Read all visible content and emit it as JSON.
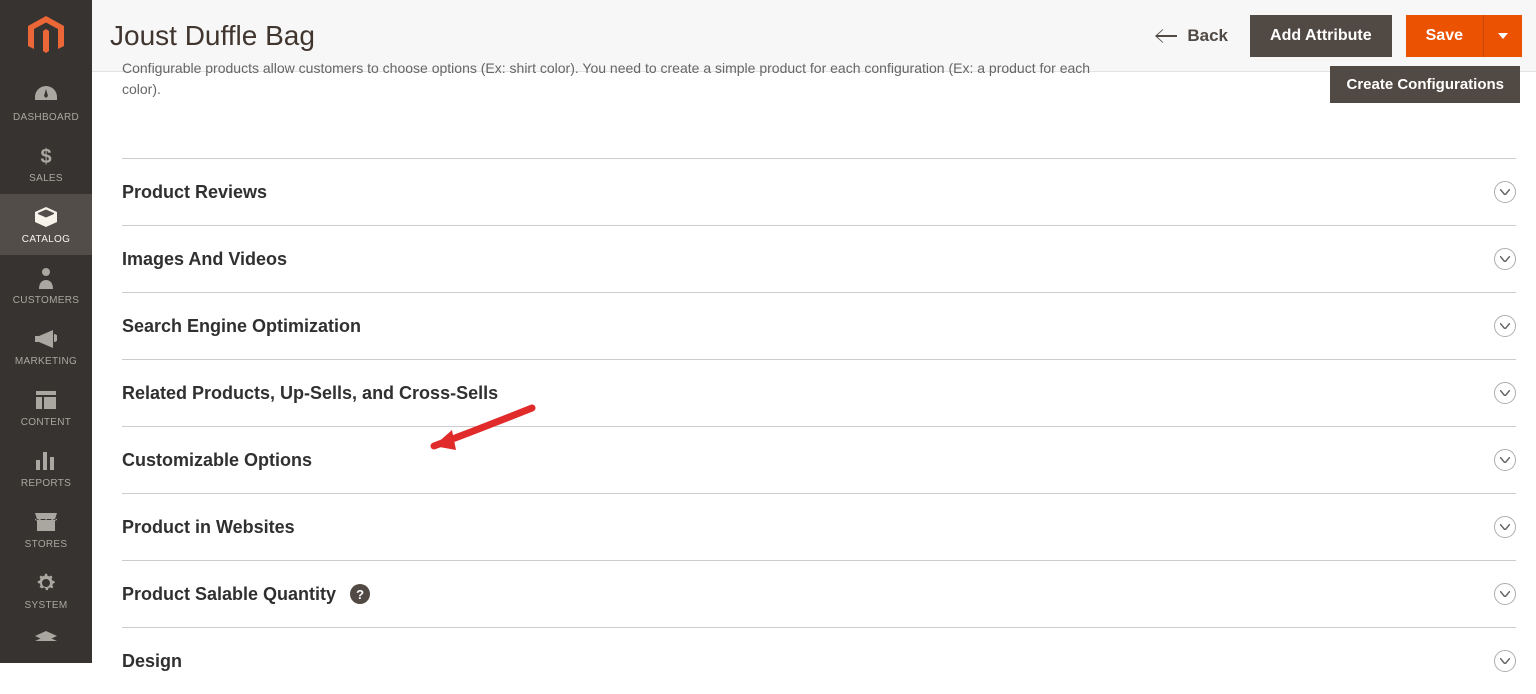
{
  "header": {
    "title": "Joust Duffle Bag",
    "back_label": "Back",
    "add_attribute_label": "Add Attribute",
    "save_label": "Save"
  },
  "config_section": {
    "description": "Configurable products allow customers to choose options (Ex: shirt color). You need to create a simple product for each configuration (Ex: a product for each color).",
    "create_button": "Create Configurations"
  },
  "fieldsets": [
    {
      "label": "Product Reviews",
      "has_help": false
    },
    {
      "label": "Images And Videos",
      "has_help": false
    },
    {
      "label": "Search Engine Optimization",
      "has_help": false
    },
    {
      "label": "Related Products, Up-Sells, and Cross-Sells",
      "has_help": false
    },
    {
      "label": "Customizable Options",
      "has_help": false
    },
    {
      "label": "Product in Websites",
      "has_help": false
    },
    {
      "label": "Product Salable Quantity",
      "has_help": true
    },
    {
      "label": "Design",
      "has_help": false
    }
  ],
  "sidebar": {
    "items": [
      {
        "label": "DASHBOARD",
        "icon": "dashboard-icon"
      },
      {
        "label": "SALES",
        "icon": "dollar-icon"
      },
      {
        "label": "CATALOG",
        "icon": "box-icon",
        "active": true
      },
      {
        "label": "CUSTOMERS",
        "icon": "person-icon"
      },
      {
        "label": "MARKETING",
        "icon": "megaphone-icon"
      },
      {
        "label": "CONTENT",
        "icon": "layout-icon"
      },
      {
        "label": "REPORTS",
        "icon": "barchart-icon"
      },
      {
        "label": "STORES",
        "icon": "storefront-icon"
      },
      {
        "label": "SYSTEM",
        "icon": "gear-icon"
      }
    ]
  }
}
